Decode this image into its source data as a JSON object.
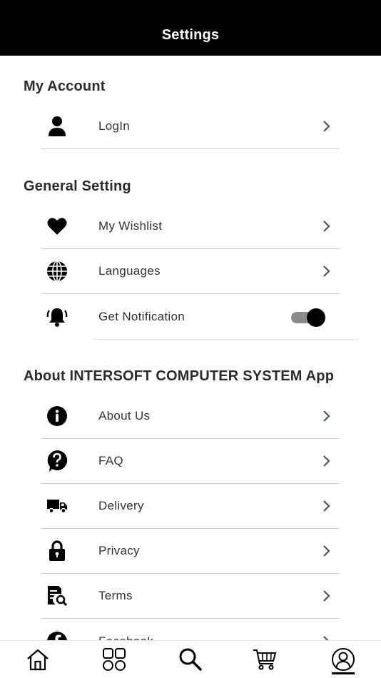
{
  "header": {
    "title": "Settings"
  },
  "sections": {
    "account": {
      "title": "My Account",
      "items": [
        {
          "label": "LogIn",
          "icon": "user-icon"
        }
      ]
    },
    "general": {
      "title": "General Setting",
      "items": [
        {
          "label": "My Wishlist",
          "icon": "heart-icon"
        },
        {
          "label": "Languages",
          "icon": "globe-icon"
        },
        {
          "label": "Get Notification",
          "icon": "bell-icon",
          "toggle_on": true
        }
      ]
    },
    "about": {
      "title": "About INTERSOFT COMPUTER SYSTEM App",
      "items": [
        {
          "label": "About Us",
          "icon": "info-icon"
        },
        {
          "label": "FAQ",
          "icon": "question-icon"
        },
        {
          "label": "Delivery",
          "icon": "truck-icon"
        },
        {
          "label": "Privacy",
          "icon": "lock-icon"
        },
        {
          "label": "Terms",
          "icon": "document-search-icon"
        },
        {
          "label": "Facebook",
          "icon": "facebook-icon"
        }
      ]
    }
  },
  "tabbar": {
    "items": [
      {
        "icon": "home-icon"
      },
      {
        "icon": "categories-icon"
      },
      {
        "icon": "search-icon"
      },
      {
        "icon": "cart-icon"
      },
      {
        "icon": "profile-icon",
        "active": true
      }
    ]
  },
  "colors": {
    "header_bg": "#000000",
    "divider": "#cfcfcf",
    "chevron": "#4a5560",
    "toggle_track": "#8a8a8a"
  }
}
